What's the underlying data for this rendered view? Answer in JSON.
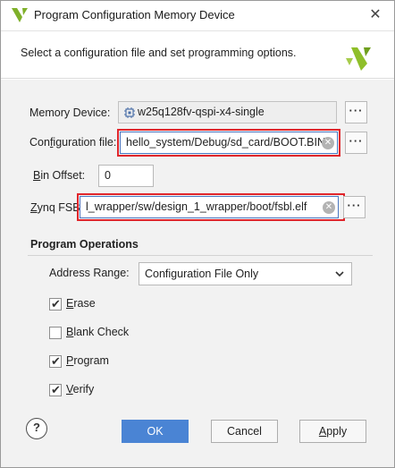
{
  "window": {
    "title": "Program Configuration Memory Device",
    "close_glyph": "✕"
  },
  "header": {
    "instructions": "Select a configuration file and set programming options."
  },
  "memory_device": {
    "label": "Memory Device:",
    "value": "w25q128fv-qspi-x4-single",
    "icon": "chip-icon",
    "browse_label": "···"
  },
  "configuration_file": {
    "label_pre": "Con",
    "label_underline": "f",
    "label_post": "iguration file:",
    "value": "hello_system/Debug/sd_card/BOOT.BIN",
    "browse_label": "···"
  },
  "bin_offset": {
    "label_pre": "",
    "label_underline": "B",
    "label_post": "in Offset:",
    "value": "0"
  },
  "zynq_fsbl": {
    "label_pre": "",
    "label_underline": "Z",
    "label_post": "ynq FSBL:",
    "value": "l_wrapper/sw/design_1_wrapper/boot/fsbl.elf",
    "browse_label": "···"
  },
  "program_operations": {
    "title": "Program Operations",
    "address_range_label": "Address Range:",
    "address_range_value": "Configuration File Only",
    "options": [
      {
        "label_underline": "E",
        "label_post": "rase",
        "checked": true
      },
      {
        "label_underline": "B",
        "label_post": "lank Check",
        "checked": false
      },
      {
        "label_underline": "P",
        "label_post": "rogram",
        "checked": true
      },
      {
        "label_underline": "V",
        "label_post": "erify",
        "checked": true
      }
    ]
  },
  "footer": {
    "help_label": "?",
    "ok_label": "OK",
    "cancel_label": "Cancel",
    "apply_pre": "",
    "apply_underline": "A",
    "apply_post": "pply"
  },
  "colors": {
    "primary_button": "#4a84d4",
    "highlight_box": "#e0262c",
    "logo": "#8fbf2a"
  }
}
